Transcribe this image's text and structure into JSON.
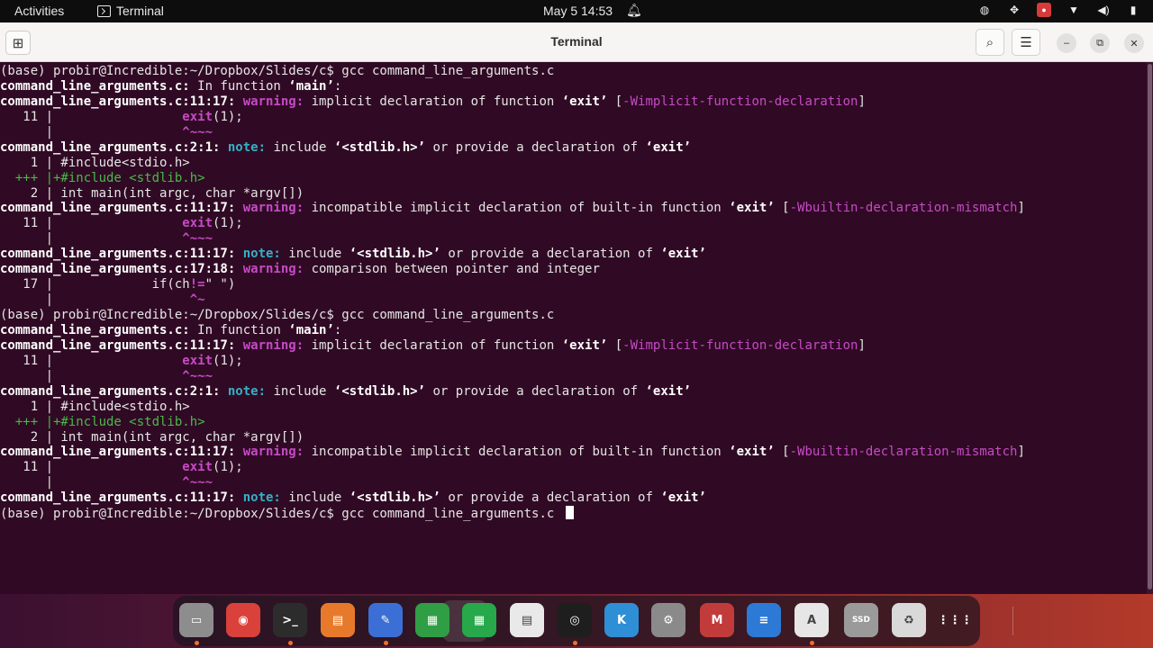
{
  "topbar": {
    "activities": "Activities",
    "app_name": "Terminal",
    "clock": "May 5  14:53"
  },
  "window": {
    "title": "Terminal"
  },
  "terminal": {
    "lines": [
      [
        [
          "",
          "(base) probir@Incredible:~/Dropbox/Slides/c$ gcc command_line_arguments.c"
        ]
      ],
      [
        [
          "b",
          "command_line_arguments.c:"
        ],
        [
          "",
          " In function "
        ],
        [
          "b",
          "‘main’"
        ],
        [
          "",
          ":"
        ]
      ],
      [
        [
          "b",
          "command_line_arguments.c:11:17: "
        ],
        [
          "w",
          "warning: "
        ],
        [
          "",
          "implicit declaration of function "
        ],
        [
          "b",
          "‘exit’"
        ],
        [
          "",
          " ["
        ],
        [
          "m",
          "-Wimplicit-function-declaration"
        ],
        [
          "",
          "]"
        ]
      ],
      [
        [
          "",
          "   11 |                 "
        ],
        [
          "w",
          "exit"
        ],
        [
          "",
          "(1);"
        ]
      ],
      [
        [
          "",
          "      |                 "
        ],
        [
          "caret",
          "^~~~"
        ]
      ],
      [
        [
          "b",
          "command_line_arguments.c:2:1: "
        ],
        [
          "n",
          "note: "
        ],
        [
          "",
          "include "
        ],
        [
          "b",
          "‘<stdlib.h>’"
        ],
        [
          "",
          " or provide a declaration of "
        ],
        [
          "b",
          "‘exit’"
        ]
      ],
      [
        [
          "",
          "    1 | #include<stdio.h>"
        ]
      ],
      [
        [
          "g",
          "  +++ |+#include <stdlib.h>"
        ]
      ],
      [
        [
          "",
          "    2 | int main(int argc, char *argv[])"
        ]
      ],
      [
        [
          "b",
          "command_line_arguments.c:11:17: "
        ],
        [
          "w",
          "warning: "
        ],
        [
          "",
          "incompatible implicit declaration of built-in function "
        ],
        [
          "b",
          "‘exit’"
        ],
        [
          "",
          " ["
        ],
        [
          "m",
          "-Wbuiltin-declaration-mismatch"
        ],
        [
          "",
          "]"
        ]
      ],
      [
        [
          "",
          "   11 |                 "
        ],
        [
          "w",
          "exit"
        ],
        [
          "",
          "(1);"
        ]
      ],
      [
        [
          "",
          "      |                 "
        ],
        [
          "caret",
          "^~~~"
        ]
      ],
      [
        [
          "b",
          "command_line_arguments.c:11:17: "
        ],
        [
          "n",
          "note: "
        ],
        [
          "",
          "include "
        ],
        [
          "b",
          "‘<stdlib.h>’"
        ],
        [
          "",
          " or provide a declaration of "
        ],
        [
          "b",
          "‘exit’"
        ]
      ],
      [
        [
          "b",
          "command_line_arguments.c:17:18: "
        ],
        [
          "w",
          "warning: "
        ],
        [
          "",
          "comparison between pointer and integer"
        ]
      ],
      [
        [
          "",
          "   17 |             if(ch"
        ],
        [
          "w",
          "!="
        ],
        [
          "",
          "\" \")"
        ]
      ],
      [
        [
          "",
          "      |                  "
        ],
        [
          "caret",
          "^~"
        ]
      ],
      [
        [
          "",
          "(base) probir@Incredible:~/Dropbox/Slides/c$ gcc command_line_arguments.c"
        ]
      ],
      [
        [
          "b",
          "command_line_arguments.c:"
        ],
        [
          "",
          " In function "
        ],
        [
          "b",
          "‘main’"
        ],
        [
          "",
          ":"
        ]
      ],
      [
        [
          "b",
          "command_line_arguments.c:11:17: "
        ],
        [
          "w",
          "warning: "
        ],
        [
          "",
          "implicit declaration of function "
        ],
        [
          "b",
          "‘exit’"
        ],
        [
          "",
          " ["
        ],
        [
          "m",
          "-Wimplicit-function-declaration"
        ],
        [
          "",
          "]"
        ]
      ],
      [
        [
          "",
          "   11 |                 "
        ],
        [
          "w",
          "exit"
        ],
        [
          "",
          "(1);"
        ]
      ],
      [
        [
          "",
          "      |                 "
        ],
        [
          "caret",
          "^~~~"
        ]
      ],
      [
        [
          "b",
          "command_line_arguments.c:2:1: "
        ],
        [
          "n",
          "note: "
        ],
        [
          "",
          "include "
        ],
        [
          "b",
          "‘<stdlib.h>’"
        ],
        [
          "",
          " or provide a declaration of "
        ],
        [
          "b",
          "‘exit’"
        ]
      ],
      [
        [
          "",
          "    1 | #include<stdio.h>"
        ]
      ],
      [
        [
          "g",
          "  +++ |+#include <stdlib.h>"
        ]
      ],
      [
        [
          "",
          "    2 | int main(int argc, char *argv[])"
        ]
      ],
      [
        [
          "b",
          "command_line_arguments.c:11:17: "
        ],
        [
          "w",
          "warning: "
        ],
        [
          "",
          "incompatible implicit declaration of built-in function "
        ],
        [
          "b",
          "‘exit’"
        ],
        [
          "",
          " ["
        ],
        [
          "m",
          "-Wbuiltin-declaration-mismatch"
        ],
        [
          "",
          "]"
        ]
      ],
      [
        [
          "",
          "   11 |                 "
        ],
        [
          "w",
          "exit"
        ],
        [
          "",
          "(1);"
        ]
      ],
      [
        [
          "",
          "      |                 "
        ],
        [
          "caret",
          "^~~~"
        ]
      ],
      [
        [
          "b",
          "command_line_arguments.c:11:17: "
        ],
        [
          "n",
          "note: "
        ],
        [
          "",
          "include "
        ],
        [
          "b",
          "‘<stdlib.h>’"
        ],
        [
          "",
          " or provide a declaration of "
        ],
        [
          "b",
          "‘exit’"
        ]
      ],
      [
        [
          "",
          "(base) probir@Incredible:~/Dropbox/Slides/c$ gcc command_line_arguments.c "
        ]
      ]
    ]
  },
  "dock": {
    "apps": [
      {
        "name": "files-icon",
        "glyph": "▭",
        "color": "#8d8d8d",
        "running": true
      },
      {
        "name": "chrome-icon",
        "glyph": "◉",
        "color": "#d9413a",
        "running": false
      },
      {
        "name": "terminal-icon",
        "glyph": ">_",
        "color": "#2c2c2c",
        "running": true
      },
      {
        "name": "impress-icon",
        "glyph": "▤",
        "color": "#e77a2a",
        "running": false
      },
      {
        "name": "text-editor-icon",
        "glyph": "✎",
        "color": "#3b6fd6",
        "running": true
      },
      {
        "name": "calc-icon",
        "glyph": "▦",
        "color": "#2f9e44",
        "running": false
      },
      {
        "name": "spreadsheet-icon",
        "glyph": "▦",
        "color": "#27a84a",
        "running": false
      },
      {
        "name": "document-viewer-icon",
        "glyph": "▤",
        "color": "#e9e9e9",
        "running": false
      },
      {
        "name": "obs-icon",
        "glyph": "◎",
        "color": "#1e1e1e",
        "running": true
      },
      {
        "name": "kdenlive-icon",
        "glyph": "K",
        "color": "#2f8fd6",
        "running": false
      },
      {
        "name": "settings-icon",
        "glyph": "⚙",
        "color": "#8a8a8a",
        "running": false
      },
      {
        "name": "mendeley-icon",
        "glyph": "M",
        "color": "#c23b3b",
        "running": false
      },
      {
        "name": "writer-icon",
        "glyph": "≡",
        "color": "#2d7ad6",
        "running": false
      },
      {
        "name": "software-updater-icon",
        "glyph": "A",
        "color": "#e6e6e6",
        "running": true
      },
      {
        "name": "disk-icon",
        "glyph": "SSD",
        "color": "#9a9a9a",
        "running": false
      },
      {
        "name": "trash-icon",
        "glyph": "♻",
        "color": "#d9d9d9",
        "running": false
      },
      {
        "name": "show-apps-icon",
        "glyph": "⋮⋮⋮",
        "color": "transparent",
        "running": false
      }
    ]
  }
}
